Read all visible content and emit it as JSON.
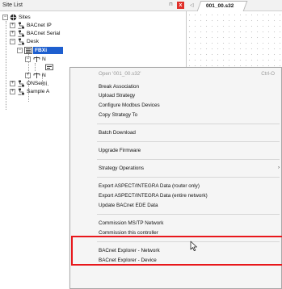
{
  "panel": {
    "title": "Site List",
    "pin_icon": "pin-icon",
    "close_icon": "close-icon",
    "close_glyph": "x"
  },
  "tree": {
    "sites": "Sites",
    "bacnet_ip": "BACnet IP",
    "bacnet_serial": "BACnet Serial",
    "desk": "Desk",
    "selected_node": "FBXi",
    "child_1": "N",
    "child_3": "N",
    "onsemi": "ONSemi",
    "sample": "Sample A"
  },
  "document": {
    "tab_label": "001_00.s32",
    "tab_arrow": "◁"
  },
  "context_menu": {
    "open": "Open '001_00.s32'",
    "open_shortcut": "Ctrl-O",
    "break_association": "Break Association",
    "upload_strategy": "Upload Strategy",
    "configure_modbus": "Configure Modbus Devices",
    "copy_strategy": "Copy Strategy To",
    "batch_download": "Batch Download",
    "upgrade_firmware": "Upgrade Firmware",
    "strategy_operations": "Strategy Operations",
    "strategy_operations_arrow": "›",
    "export_router": "Export ASPECT/INTEGRA Data (router only)",
    "export_network": "Export ASPECT/INTEGRA Data (entire network)",
    "update_ede": "Update BACnet EDE Data",
    "commission_mstp": "Commission MS/TP Network",
    "commission_controller": "Commission this controller",
    "explorer_network": "BACnet Explorer - Network",
    "explorer_device": "BACnet Explorer - Device"
  },
  "colors": {
    "highlight": "#e8171b",
    "selection": "#1e5fcf",
    "close_button": "#e0302a"
  }
}
